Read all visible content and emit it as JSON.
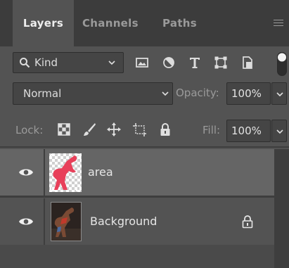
{
  "tabs": [
    {
      "label": "Layers",
      "active": true
    },
    {
      "label": "Channels",
      "active": false
    },
    {
      "label": "Paths",
      "active": false
    }
  ],
  "filter": {
    "kind_label": "Kind",
    "icons": [
      "image-filter-icon",
      "adjustment-filter-icon",
      "type-filter-icon",
      "shape-filter-icon",
      "smart-object-filter-icon",
      "filter-toggle"
    ]
  },
  "blend": {
    "mode": "Normal",
    "opacity_label": "Opacity:",
    "opacity_value": "100%"
  },
  "lock": {
    "label": "Lock:",
    "icons": [
      "lock-transparent-pixels-icon",
      "lock-image-pixels-icon",
      "lock-position-icon",
      "lock-artboard-icon",
      "lock-all-icon"
    ],
    "fill_label": "Fill:",
    "fill_value": "100%"
  },
  "layers": [
    {
      "name": "area",
      "visible": true,
      "selected": true,
      "locked": false
    },
    {
      "name": "Background",
      "visible": true,
      "selected": false,
      "locked": true
    }
  ],
  "colors": {
    "panel_bg": "#535353",
    "tab_bar_bg": "#3c3c3c",
    "selected_layer": "#656565",
    "mask_color": "#e8405a"
  }
}
